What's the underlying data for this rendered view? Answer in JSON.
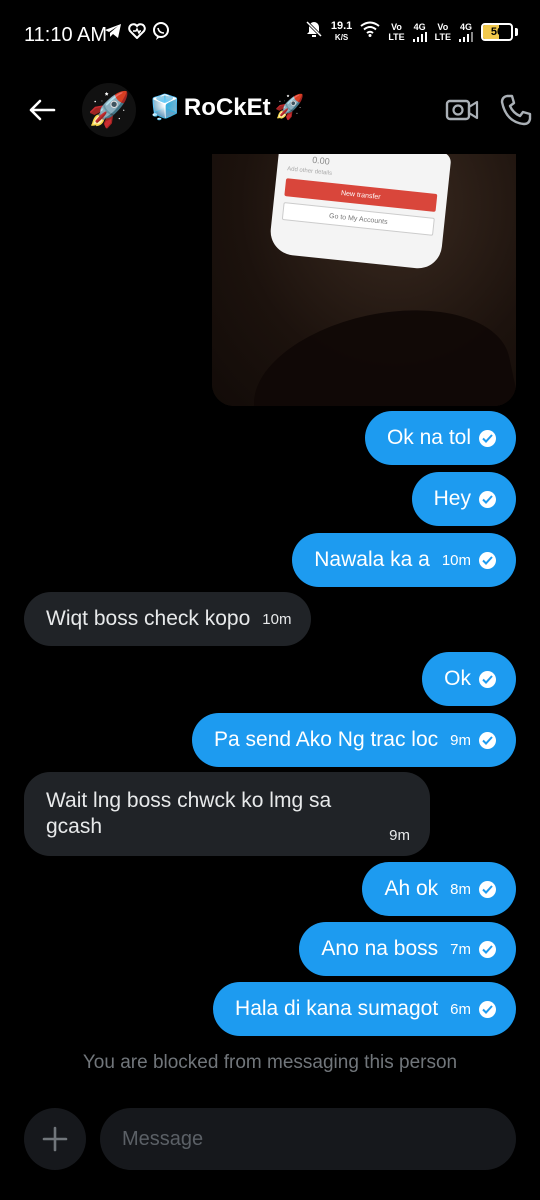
{
  "status_bar": {
    "time": "11:10 AM",
    "net_speed_value": "19.1",
    "net_speed_unit": "K/S",
    "sim1_top": "Vo",
    "sim1_bottom": "LTE",
    "sim1_gen": "4G",
    "sim2_top": "Vo",
    "sim2_bottom": "LTE",
    "sim2_gen": "4G",
    "battery_level": "56",
    "battery_fraction": 0.56,
    "icons": [
      "telegram-icon",
      "heart-app-icon",
      "viber-icon",
      "mute-icon",
      "wifi-icon",
      "signal-icon",
      "battery-icon"
    ]
  },
  "header": {
    "back_icon": "arrow-left-icon",
    "avatar_emoji": "🚀",
    "name_prefix_emoji": "🧊",
    "name": "RoCkEt",
    "name_suffix_emoji": "🚀",
    "video_icon": "video-camera-icon",
    "call_icon": "phone-icon"
  },
  "shared_image": {
    "amount_text": "0.00",
    "note_text": "Add other details",
    "primary_button": "New transfer",
    "secondary_button": "Go to My Accounts"
  },
  "messages": [
    {
      "direction": "out",
      "text": "Ok na tol",
      "time": "",
      "read": true
    },
    {
      "direction": "out",
      "text": "Hey",
      "time": "",
      "read": true
    },
    {
      "direction": "out",
      "text": "Nawala ka a",
      "time": "10m",
      "read": true
    },
    {
      "direction": "in",
      "text": "Wiqt boss check kopo",
      "time": "10m"
    },
    {
      "direction": "out",
      "text": "Ok",
      "time": "",
      "read": true
    },
    {
      "direction": "out",
      "text": "Pa send Ako Ng trac loc",
      "time": "9m",
      "read": true
    },
    {
      "direction": "in",
      "text": "Wait lng boss chwck ko lmg sa gcash",
      "time": "9m"
    },
    {
      "direction": "out",
      "text": "Ah ok",
      "time": "8m",
      "read": true
    },
    {
      "direction": "out",
      "text": "Ano na boss",
      "time": "7m",
      "read": true
    },
    {
      "direction": "out",
      "text": "Hala di kana sumagot",
      "time": "6m",
      "read": true
    }
  ],
  "blocked_text": "You are blocked from messaging this person",
  "composer": {
    "placeholder": "Message",
    "add_icon": "plus-icon"
  },
  "colors": {
    "background": "#000000",
    "outgoing_bubble": "#1d9bf0",
    "incoming_bubble": "#202327",
    "muted_text": "#71767b",
    "battery": "#f2c94c"
  }
}
